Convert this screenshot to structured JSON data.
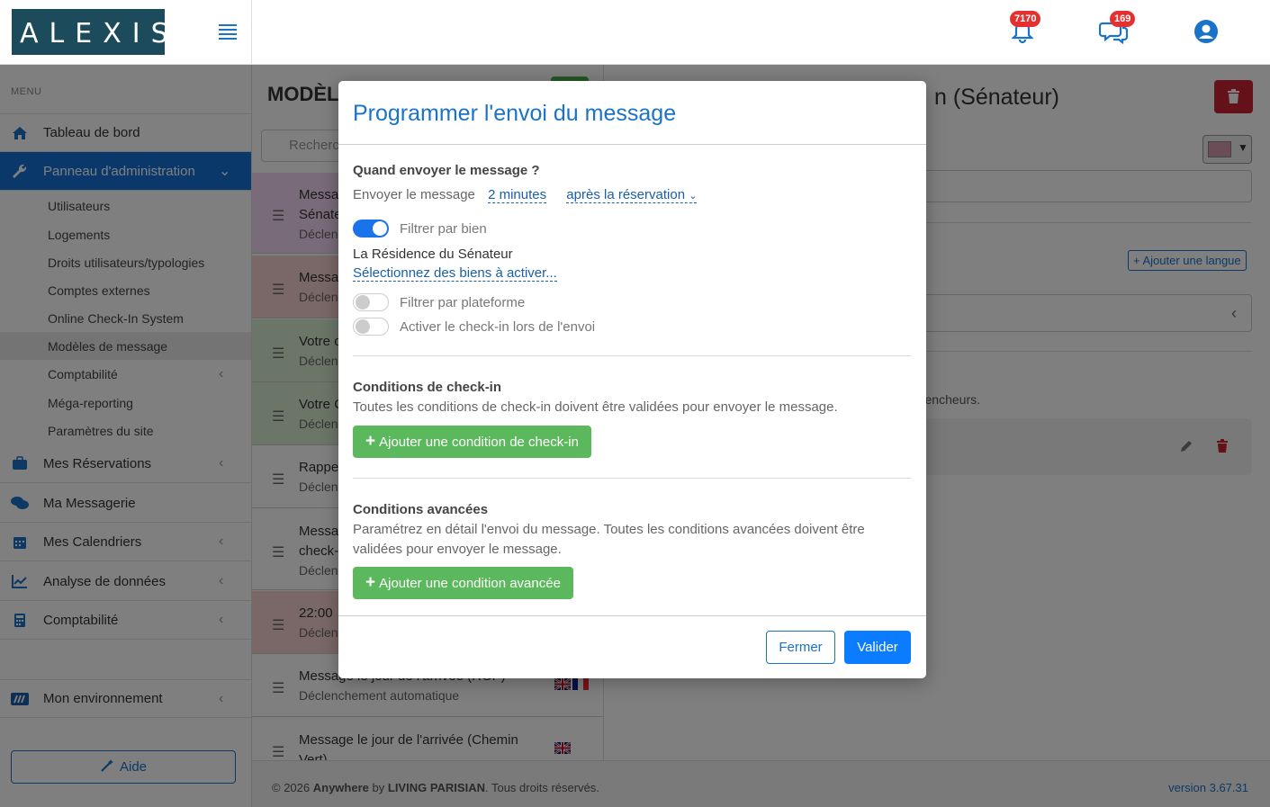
{
  "app": {
    "logo_text": "ALEXIS",
    "notifications_count": "7170",
    "messages_count": "169"
  },
  "sidebar": {
    "menu_label": "MENU",
    "items": [
      {
        "label": "Tableau de bord"
      },
      {
        "label": "Panneau d'administration"
      },
      {
        "label": "Mes Réservations"
      },
      {
        "label": "Ma Messagerie"
      },
      {
        "label": "Mes Calendriers"
      },
      {
        "label": "Analyse de données"
      },
      {
        "label": "Comptabilité"
      },
      {
        "label": "Mon environnement"
      }
    ],
    "sub_items": [
      {
        "label": "Utilisateurs"
      },
      {
        "label": "Logements"
      },
      {
        "label": "Droits utilisateurs/typologies"
      },
      {
        "label": "Comptes externes"
      },
      {
        "label": "Online Check-In System"
      },
      {
        "label": "Modèles de message"
      },
      {
        "label": "Comptabilité"
      },
      {
        "label": "Méga-reporting"
      },
      {
        "label": "Paramètres du site"
      }
    ],
    "help_label": "Aide"
  },
  "list": {
    "title": "MODÈL",
    "search_placeholder": "Recherc",
    "templates": [
      {
        "t1": "Messa",
        "t2": "Sénate",
        "t3": "Déclen"
      },
      {
        "t1": "Messa",
        "t2": "Déclen"
      },
      {
        "t1": "Votre c",
        "t2": "Déclen"
      },
      {
        "t1": "Votre C",
        "t2": "Déclen"
      },
      {
        "t1": "Rappe",
        "t2": "Déclen"
      },
      {
        "t1": "Messa",
        "t2": "check-",
        "t3": "Déclen"
      },
      {
        "t1": "22:00",
        "t2": "Déclen"
      },
      {
        "t1": "Message le jour de l'arrivée (RGP)",
        "t2": "Déclenchement automatique"
      },
      {
        "t1": "Message le jour de l'arrivée (Chemin",
        "t2": "Vert)"
      }
    ]
  },
  "detail": {
    "title_fragment": "n (Sénateur)",
    "add_language": "Ajouter une langue",
    "triggers_text": "encheurs."
  },
  "footer": {
    "year": "© 2026",
    "brand": "Anywhere",
    "by": "by",
    "company": "LIVING PARISIAN",
    "rights": ". Tous droits réservés.",
    "version": "version 3.67.31"
  },
  "modal": {
    "title": "Programmer l'envoi du message",
    "when_heading": "Quand envoyer le message ?",
    "send_label": "Envoyer le message",
    "delay_value": "2 minutes",
    "relative_value": "après la réservation",
    "filter_property_label": "Filtrer par bien",
    "filter_property_on": true,
    "selected_property": "La Résidence du Sénateur",
    "select_properties_link": "Sélectionnez des biens à activer...",
    "filter_platform_label": "Filtrer par plateforme",
    "filter_platform_on": false,
    "checkin_on_send_label": "Activer le check-in lors de l'envoi",
    "checkin_on_send_on": false,
    "checkin_heading": "Conditions de check-in",
    "checkin_desc": "Toutes les conditions de check-in doivent être validées pour envoyer le message.",
    "add_checkin_label": "Ajouter une condition de check-in",
    "advanced_heading": "Conditions avancées",
    "advanced_desc_1": "Paramétrez en détail l'envoi du message. Toutes les conditions avancées doivent être",
    "advanced_desc_2": "validées pour envoyer le message.",
    "add_advanced_label": "Ajouter une condition avancée",
    "close_label": "Fermer",
    "validate_label": "Valider"
  },
  "colors": {
    "primary": "#1a73c8",
    "sidebar_active": "#1470d6",
    "success": "#5cb85c",
    "danger": "#c82333",
    "badge": "#e53030"
  }
}
